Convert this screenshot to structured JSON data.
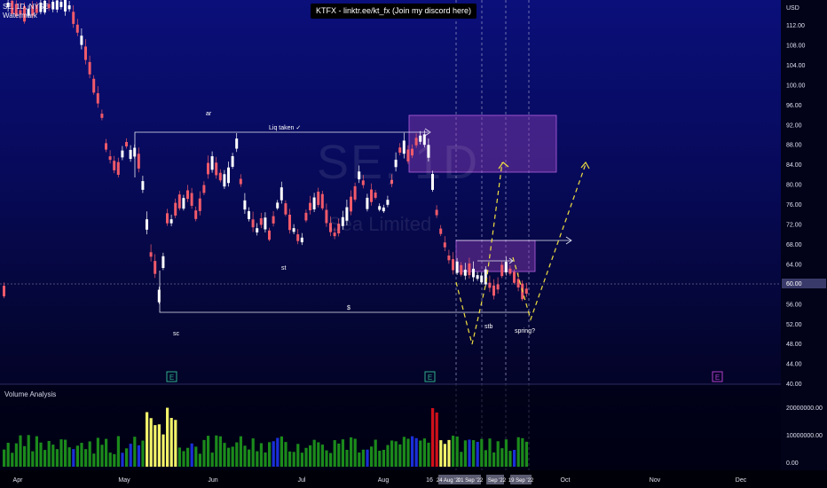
{
  "header": {
    "symbol": "SE, 1D, NYSE",
    "indicator": "Watermark"
  },
  "banner": {
    "text": "KTFX - linktr.ee/kt_fx (Join my discord here)"
  },
  "watermark": {
    "ticker": "SE, 1D",
    "name": "Sea Limited"
  },
  "price_axis": {
    "currency": "USD",
    "labels": [
      "112.00",
      "108.00",
      "104.00",
      "100.00",
      "96.00",
      "92.00",
      "88.00",
      "84.00",
      "80.00",
      "76.00",
      "72.00",
      "68.00",
      "64.00",
      "60.00",
      "56.00",
      "52.00",
      "48.00",
      "44.00",
      "40.00"
    ]
  },
  "volume_axis": {
    "labels": [
      "20000000.00",
      "10000000.00",
      "0.00"
    ]
  },
  "volume_panel": {
    "title": "Volume Analysis"
  },
  "time_axis": {
    "labels": [
      "Apr",
      "May",
      "Jun",
      "Jul",
      "Aug",
      "16",
      "Oct",
      "Nov",
      "Dec"
    ],
    "highlight_labels": [
      "24 Aug '22",
      "01 Sep '22",
      "Sep '22",
      "19 Sep '22"
    ]
  },
  "annotations": {
    "ar": "ar",
    "liq": "Liq taken ✓",
    "st": "st",
    "sc": "sc",
    "dollar": "$",
    "stb": "stb",
    "spring": "spring?"
  },
  "earnings_markers": [
    "E",
    "E",
    "E"
  ],
  "colors": {
    "bull": "#ffffff",
    "bear": "#f05a6a",
    "vol_green": "#1b8a1b",
    "vol_yellow": "#f2f26a",
    "vol_red": "#d0101a",
    "vol_blue": "#1a2fd8",
    "zone": "#8b3fb5",
    "path": "#f0e040"
  }
}
